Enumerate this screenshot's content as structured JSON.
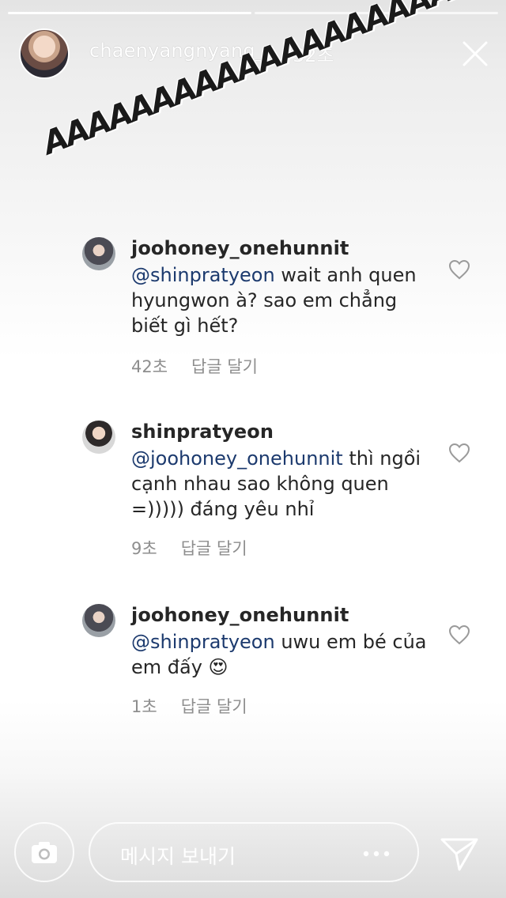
{
  "header": {
    "username": "chaenyangnyang_",
    "time": "32초"
  },
  "sticker_text": "AAAAAAAAAAAAAAAAAAAA",
  "comments": [
    {
      "username": "joohoney_onehunnit",
      "mention": "@shinpratyeon",
      "text": " wait anh quen hyungwon à? sao em chẳng biết gì hết?",
      "time": "42초",
      "reply_label": "답글 달기"
    },
    {
      "username": "shinpratyeon",
      "mention": "@joohoney_onehunnit",
      "text": " thì ngồi cạnh nhau sao không quen =))))) đáng yêu nhỉ",
      "time": "9초",
      "reply_label": "답글 달기"
    },
    {
      "username": "joohoney_onehunnit",
      "mention": "@shinpratyeon",
      "text": " uwu em bé của em đấy 😍",
      "time": "1초",
      "reply_label": "답글 달기"
    }
  ],
  "bottom": {
    "message_placeholder": "메시지 보내기"
  },
  "colors": {
    "text": "#262626",
    "mention": "#1c3a6e",
    "meta": "#8e8e8e"
  }
}
